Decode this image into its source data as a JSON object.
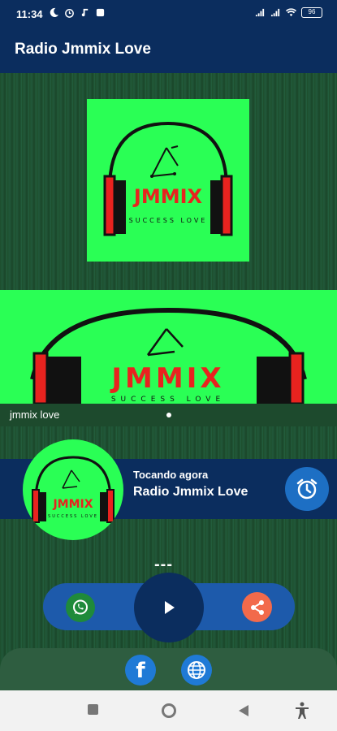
{
  "status_bar": {
    "time": "11:34",
    "battery": "96",
    "left_icons": [
      "moon-icon",
      "alarm-clock-icon",
      "music-note-icon",
      "notification-square-icon"
    ],
    "right_icons": [
      "signal-icon",
      "signal-icon",
      "wifi-icon",
      "battery-icon"
    ]
  },
  "app_bar": {
    "title": "Radio Jmmix Love"
  },
  "logo": {
    "brand": "JMMIX",
    "tagline": "SUCCESS LOVE"
  },
  "banner": {
    "caption": "jmmix love"
  },
  "now_playing": {
    "label": "Tocando agora",
    "station": "Radio Jmmix Love"
  },
  "player": {
    "metadata": "---"
  },
  "colors": {
    "primary_dark": "#0b2d5e",
    "accent_blue": "#1d6fc4",
    "logo_green": "#2aff55",
    "logo_red": "#e8231f",
    "whatsapp_green": "#1f8a3a",
    "share_orange": "#f26a4b"
  },
  "icons": {
    "alarm": "alarm-clock-icon",
    "whatsapp": "whatsapp-icon",
    "play": "play-icon",
    "share": "share-icon",
    "facebook": "facebook-icon",
    "web": "globe-icon"
  }
}
